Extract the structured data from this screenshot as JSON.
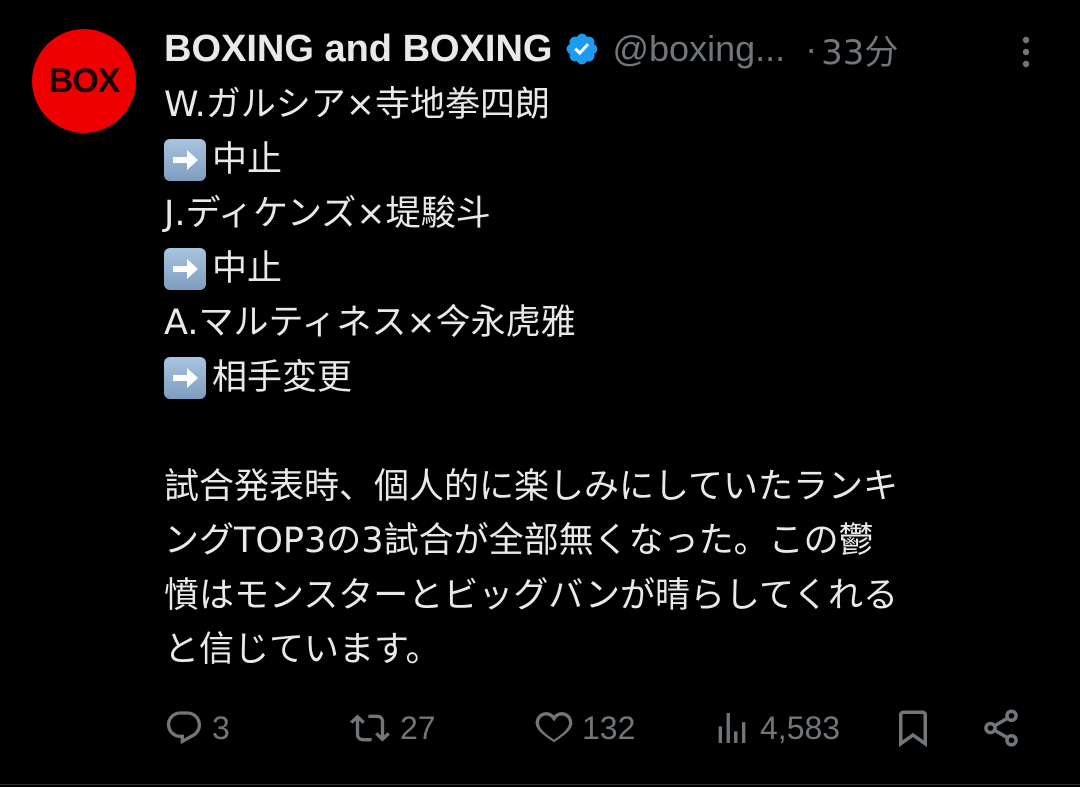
{
  "avatar": {
    "text": "BOX",
    "color": "#ee0000"
  },
  "author": {
    "name": "BOXING and BOXING",
    "handle": "@boxing...",
    "separator": "·",
    "time": "33分",
    "verified_icon": "verified-badge-icon",
    "verified_color": "#1d9bf0"
  },
  "tweet": {
    "lines": [
      {
        "arrow": false,
        "text": "W.ガルシア×寺地拳四朗"
      },
      {
        "arrow": true,
        "text": "中止"
      },
      {
        "arrow": false,
        "text": "J.ディケンズ×堤駿斗"
      },
      {
        "arrow": true,
        "text": "中止"
      },
      {
        "arrow": false,
        "text": "A.マルティネス×今永虎雅"
      },
      {
        "arrow": true,
        "text": "相手変更"
      }
    ],
    "paragraph_lines": [
      "試合発表時、個人的に楽しみにしていたランキ",
      "ングTOP3の3試合が全部無くなった。この鬱",
      "憤はモンスターとビッグバンが晴らしてくれる",
      "と信じています。"
    ]
  },
  "actions": {
    "reply": {
      "icon": "reply-icon",
      "count": "3"
    },
    "retweet": {
      "icon": "retweet-icon",
      "count": "27"
    },
    "like": {
      "icon": "heart-icon",
      "count": "132"
    },
    "views": {
      "icon": "views-chart-icon",
      "count": "4,583"
    },
    "bookmark": {
      "icon": "bookmark-icon"
    },
    "share": {
      "icon": "share-icon"
    }
  },
  "colors": {
    "background": "#000000",
    "text": "#e7e9ea",
    "muted": "#71767b"
  }
}
